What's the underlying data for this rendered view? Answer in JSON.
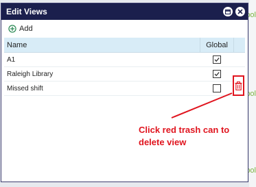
{
  "dialog": {
    "title": "Edit Views",
    "minimize_icon": "minimize-icon",
    "close_icon": "close-icon"
  },
  "toolbar": {
    "add_label": "Add",
    "add_icon": "plus-circle-icon"
  },
  "table": {
    "columns": [
      "Name",
      "Global"
    ],
    "rows": [
      {
        "name": "A1",
        "global": true
      },
      {
        "name": "Raleigh Library",
        "global": true
      },
      {
        "name": "Missed shift",
        "global": false
      }
    ]
  },
  "background": {
    "text_1": "pol",
    "text_2": "pol",
    "text_3": "ool"
  },
  "annotation": {
    "text": "Click red trash can to delete view",
    "color": "#e0141e"
  },
  "colors": {
    "titlebar": "#1b1f4d",
    "header": "#d8ecf7",
    "accent_red": "#e0141e",
    "add_icon": "#2e8b57"
  }
}
